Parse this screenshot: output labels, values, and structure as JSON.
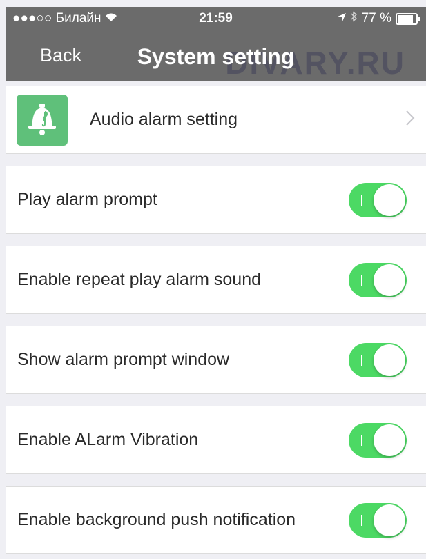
{
  "status_bar": {
    "carrier": "●●●○○ Билайн",
    "time": "21:59",
    "battery": "77 %"
  },
  "nav": {
    "back_label": "Back",
    "title": "System setting",
    "watermark": "DIVARY.RU"
  },
  "audio_row": {
    "label": "Audio alarm setting"
  },
  "settings": [
    {
      "label": "Play alarm prompt",
      "on": true
    },
    {
      "label": "Enable repeat play alarm sound",
      "on": true
    },
    {
      "label": "Show alarm prompt window",
      "on": true
    },
    {
      "label": "Enable ALarm Vibration",
      "on": true
    },
    {
      "label": "Enable background push notification",
      "on": true
    }
  ],
  "colors": {
    "toggle_on": "#4cd964",
    "header_bg": "#6b6b6b",
    "icon_bg": "#5fc07a"
  }
}
